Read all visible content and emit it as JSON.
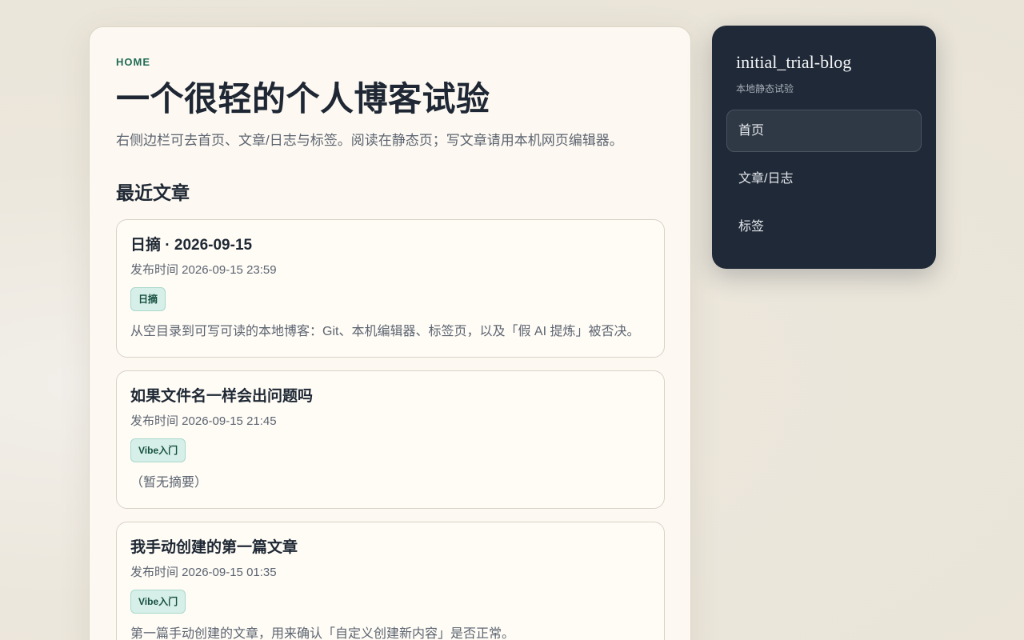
{
  "main": {
    "eyebrow": "HOME",
    "title": "一个很轻的个人博客试验",
    "description": "右侧边栏可去首页、文章/日志与标签。阅读在静态页；写文章请用本机网页编辑器。",
    "section_title": "最近文章",
    "posts": [
      {
        "title": "日摘 · 2026-09-15",
        "date": "发布时间 2026-09-15 23:59",
        "tag": "日摘",
        "excerpt": "从空目录到可写可读的本地博客：Git、本机编辑器、标签页，以及「假 AI 提炼」被否决。"
      },
      {
        "title": "如果文件名一样会出问题吗",
        "date": "发布时间 2026-09-15 21:45",
        "tag": "Vibe入门",
        "excerpt": "（暂无摘要）"
      },
      {
        "title": "我手动创建的第一篇文章",
        "date": "发布时间 2026-09-15 01:35",
        "tag": "Vibe入门",
        "excerpt": "第一篇手动创建的文章，用来确认「自定义创建新内容」是否正常。"
      }
    ]
  },
  "sidebar": {
    "brand": "initial_trial-blog",
    "subtitle": "本地静态试验",
    "nav": [
      {
        "label": "首页",
        "active": true
      },
      {
        "label": "文章/日志",
        "active": false
      },
      {
        "label": "标签",
        "active": false
      }
    ]
  },
  "colors": {
    "accent": "#1f6b55",
    "sidebar_bg": "#1f2937",
    "tag_bg": "#d6efe8",
    "page_bg": "#ece7dc"
  }
}
